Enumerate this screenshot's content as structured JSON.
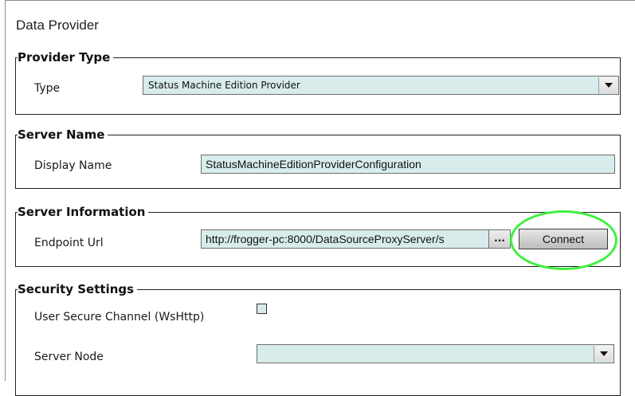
{
  "panel": {
    "title": "Data Provider"
  },
  "provider_type": {
    "legend": "Provider Type",
    "type_label": "Type",
    "type_value": "Status Machine Edition Provider"
  },
  "server_name": {
    "legend": "Server Name",
    "display_name_label": "Display Name",
    "display_name_value": "StatusMachineEditionProviderConfiguration"
  },
  "server_information": {
    "legend": "Server Information",
    "endpoint_label": "Endpoint Url",
    "endpoint_value": "http://frogger-pc:8000/DataSourceProxyServer/s",
    "browse_label": "...",
    "connect_label": "Connect",
    "highlight_color": "#3ef03e"
  },
  "security_settings": {
    "legend": "Security Settings",
    "secure_channel_label": "User Secure Channel (WsHttp)",
    "secure_channel_checked": false,
    "server_node_label": "Server Node",
    "server_node_value": ""
  },
  "colors": {
    "field_bg": "#d9ecec",
    "border": "#222222"
  }
}
